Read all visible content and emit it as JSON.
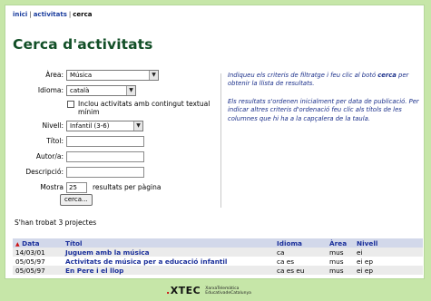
{
  "breadcrumb": {
    "home": "inici",
    "activities": "activitats",
    "current": "cerca"
  },
  "page_title": "Cerca d'activitats",
  "form": {
    "area_label": "Àrea:",
    "area_value": "Música",
    "language_label": "Idioma:",
    "language_value": "català",
    "include_label": "Inclou activitats amb contingut textual mínim",
    "level_label": "Nivell:",
    "level_value": "Infantil (3-6)",
    "title_label": "Títol:",
    "author_label": "Autor/a:",
    "description_label": "Descripció:",
    "show_label": "Mostra",
    "results_per_page": "25",
    "per_page_suffix": "resultats per pàgina",
    "search_button": "cerca..."
  },
  "help": {
    "p1_a": "Indiqueu els criteris de filtratge i feu clic al botó ",
    "p1_bold": "cerca",
    "p1_b": " per obtenir la llista de resultats.",
    "p2": "Els resultats s'ordenen inicialment per data de publicació. Per indicar altres criteris d'ordenació feu clic als títols de les columnes que hi ha a la capçalera de la taula."
  },
  "results_count": "S'han trobat 3 projectes",
  "table": {
    "headers": {
      "date": "Data",
      "title": "Títol",
      "language": "Idioma",
      "area": "Àrea",
      "level": "Nivell"
    },
    "rows": [
      {
        "date": "14/03/01",
        "title": "Juguem amb la música",
        "language": "ca",
        "area": "mus",
        "level": "ei"
      },
      {
        "date": "05/05/97",
        "title": "Activitats de música per a educació infantil",
        "language": "ca es",
        "area": "mus",
        "level": "ei ep"
      },
      {
        "date": "05/05/97",
        "title": "En Pere i el llop",
        "language": "ca es eu",
        "area": "mus",
        "level": "ei ep"
      }
    ]
  },
  "footer": {
    "logo_text": "XTEC",
    "logo_sub1": "XarxaTelemàtica",
    "logo_sub2": "EducativadeCatalunya"
  }
}
